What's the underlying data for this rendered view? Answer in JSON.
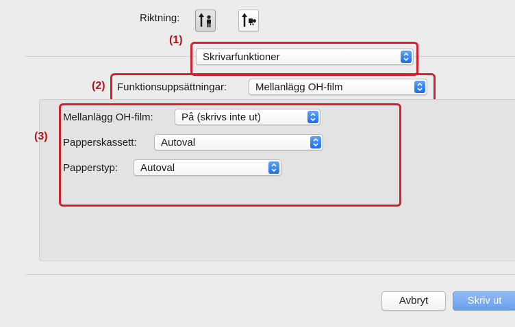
{
  "orientation": {
    "label": "Riktning:",
    "options": [
      {
        "name": "portrait",
        "selected": true
      },
      {
        "name": "landscape",
        "selected": false
      }
    ]
  },
  "callouts": {
    "c1": "(1)",
    "c2": "(2)",
    "c3": "(3)"
  },
  "panel_selector": {
    "value": "Skrivarfunktioner"
  },
  "feature_sets": {
    "label": "Funktionsuppsättningar:",
    "value": "Mellanlägg OH-film"
  },
  "settings": [
    {
      "label": "Mellanlägg OH-film:",
      "value": "På (skrivs inte ut)"
    },
    {
      "label": "Papperskassett:",
      "value": "Autoval"
    },
    {
      "label": "Papperstyp:",
      "value": "Autoval"
    }
  ],
  "footer": {
    "cancel_label": "Avbryt",
    "print_label": "Skriv ut"
  },
  "colors": {
    "callout_red": "#d51f2c",
    "accent_blue": "#1c6ef0",
    "primary_button": "#7aaaf0",
    "window_bg": "#ececec"
  }
}
